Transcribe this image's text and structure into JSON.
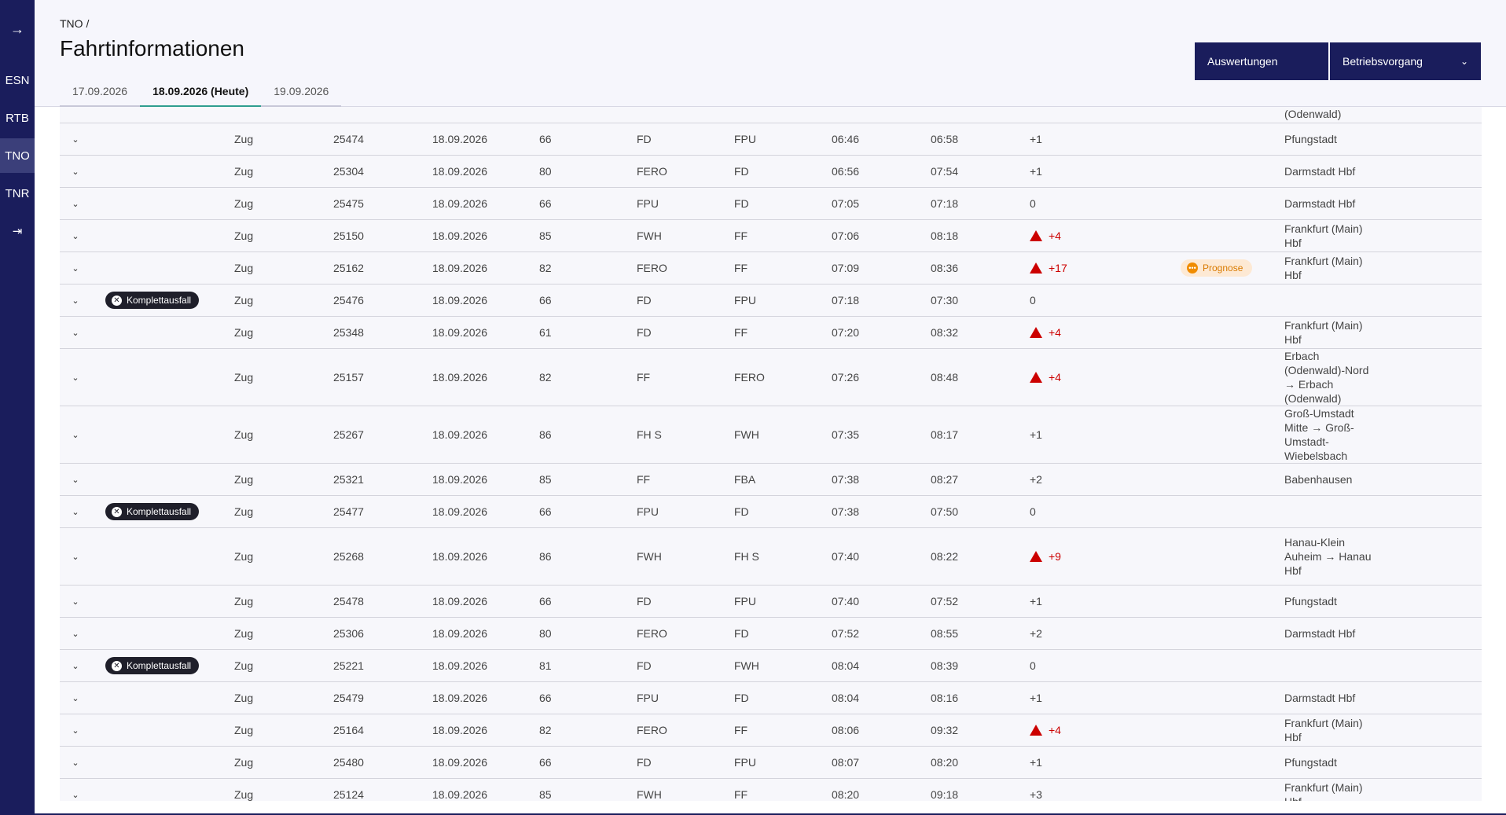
{
  "sidebar": {
    "items": [
      {
        "label": "→",
        "name": "collapse-arrow-icon"
      },
      {
        "label": "ESN"
      },
      {
        "label": "RTB"
      },
      {
        "label": "TNO"
      },
      {
        "label": "TNR"
      },
      {
        "label": "⇥",
        "name": "logout-icon"
      }
    ],
    "active": "TNO"
  },
  "header": {
    "breadcrumb": "TNO  /",
    "title": "Fahrtinformationen",
    "tabs": [
      {
        "label": "17.09.2026"
      },
      {
        "label": "18.09.2026 (Heute)",
        "active": true
      },
      {
        "label": "19.09.2026"
      }
    ],
    "btn_auswertungen": "Auswertungen",
    "btn_betriebsvorgang": "Betriebsvorgang"
  },
  "colors": {
    "primary": "#1a1d5c",
    "late": "#cc0000",
    "accent_tab": "#2f9e8f",
    "prognose": "#f08c00"
  },
  "badge_label": "Komplettausfall",
  "prognose_label": "Prognose",
  "rows": [
    {
      "type": "Zug",
      "nr": "25474",
      "date": "18.09.2026",
      "line": "66",
      "from": "FD",
      "to": "FPU",
      "dep": "06:46",
      "arr": "06:58",
      "delay": "+1",
      "late": false,
      "dest": "Pfungstadt"
    },
    {
      "type": "Zug",
      "nr": "25304",
      "date": "18.09.2026",
      "line": "80",
      "from": "FERO",
      "to": "FD",
      "dep": "06:56",
      "arr": "07:54",
      "delay": "+1",
      "late": false,
      "dest": "Darmstadt Hbf"
    },
    {
      "type": "Zug",
      "nr": "25475",
      "date": "18.09.2026",
      "line": "66",
      "from": "FPU",
      "to": "FD",
      "dep": "07:05",
      "arr": "07:18",
      "delay": "0",
      "late": false,
      "dest": "Darmstadt Hbf"
    },
    {
      "type": "Zug",
      "nr": "25150",
      "date": "18.09.2026",
      "line": "85",
      "from": "FWH",
      "to": "FF",
      "dep": "07:06",
      "arr": "08:18",
      "delay": "+4",
      "late": true,
      "dest": "Frankfurt (Main) Hbf"
    },
    {
      "type": "Zug",
      "nr": "25162",
      "date": "18.09.2026",
      "line": "82",
      "from": "FERO",
      "to": "FF",
      "dep": "07:09",
      "arr": "08:36",
      "delay": "+17",
      "late": true,
      "prognose": true,
      "dest": "Frankfurt (Main) Hbf"
    },
    {
      "type": "Zug",
      "nr": "25476",
      "date": "18.09.2026",
      "line": "66",
      "from": "FD",
      "to": "FPU",
      "dep": "07:18",
      "arr": "07:30",
      "delay": "0",
      "late": false,
      "cancelled": true,
      "dest": ""
    },
    {
      "type": "Zug",
      "nr": "25348",
      "date": "18.09.2026",
      "line": "61",
      "from": "FD",
      "to": "FF",
      "dep": "07:20",
      "arr": "08:32",
      "delay": "+4",
      "late": true,
      "dest": "Frankfurt (Main) Hbf"
    },
    {
      "type": "Zug",
      "nr": "25157",
      "date": "18.09.2026",
      "line": "82",
      "from": "FF",
      "to": "FERO",
      "dep": "07:26",
      "arr": "08:48",
      "delay": "+4",
      "late": true,
      "dest": "Erbach (Odenwald)-Nord → Erbach (Odenwald)"
    },
    {
      "type": "Zug",
      "nr": "25267",
      "date": "18.09.2026",
      "line": "86",
      "from": "FH S",
      "to": "FWH",
      "dep": "07:35",
      "arr": "08:17",
      "delay": "+1",
      "late": false,
      "dest": "Groß-Umstadt Mitte → Groß-Umstadt-Wiebelsbach"
    },
    {
      "type": "Zug",
      "nr": "25321",
      "date": "18.09.2026",
      "line": "85",
      "from": "FF",
      "to": "FBA",
      "dep": "07:38",
      "arr": "08:27",
      "delay": "+2",
      "late": false,
      "dest": "Babenhausen"
    },
    {
      "type": "Zug",
      "nr": "25477",
      "date": "18.09.2026",
      "line": "66",
      "from": "FPU",
      "to": "FD",
      "dep": "07:38",
      "arr": "07:50",
      "delay": "0",
      "late": false,
      "cancelled": true,
      "dest": ""
    },
    {
      "type": "Zug",
      "nr": "25268",
      "date": "18.09.2026",
      "line": "86",
      "from": "FWH",
      "to": "FH S",
      "dep": "07:40",
      "arr": "08:22",
      "delay": "+9",
      "late": true,
      "dest": "Hanau-Klein Auheim → Hanau Hbf"
    },
    {
      "type": "Zug",
      "nr": "25478",
      "date": "18.09.2026",
      "line": "66",
      "from": "FD",
      "to": "FPU",
      "dep": "07:40",
      "arr": "07:52",
      "delay": "+1",
      "late": false,
      "dest": "Pfungstadt"
    },
    {
      "type": "Zug",
      "nr": "25306",
      "date": "18.09.2026",
      "line": "80",
      "from": "FERO",
      "to": "FD",
      "dep": "07:52",
      "arr": "08:55",
      "delay": "+2",
      "late": false,
      "dest": "Darmstadt Hbf"
    },
    {
      "type": "Zug",
      "nr": "25221",
      "date": "18.09.2026",
      "line": "81",
      "from": "FD",
      "to": "FWH",
      "dep": "08:04",
      "arr": "08:39",
      "delay": "0",
      "late": false,
      "cancelled": true,
      "dest": ""
    },
    {
      "type": "Zug",
      "nr": "25479",
      "date": "18.09.2026",
      "line": "66",
      "from": "FPU",
      "to": "FD",
      "dep": "08:04",
      "arr": "08:16",
      "delay": "+1",
      "late": false,
      "dest": "Darmstadt Hbf"
    },
    {
      "type": "Zug",
      "nr": "25164",
      "date": "18.09.2026",
      "line": "82",
      "from": "FERO",
      "to": "FF",
      "dep": "08:06",
      "arr": "09:32",
      "delay": "+4",
      "late": true,
      "dest": "Frankfurt (Main) Hbf"
    },
    {
      "type": "Zug",
      "nr": "25480",
      "date": "18.09.2026",
      "line": "66",
      "from": "FD",
      "to": "FPU",
      "dep": "08:07",
      "arr": "08:20",
      "delay": "+1",
      "late": false,
      "dest": "Pfungstadt"
    },
    {
      "type": "Zug",
      "nr": "25124",
      "date": "18.09.2026",
      "line": "85",
      "from": "FWH",
      "to": "FF",
      "dep": "08:20",
      "arr": "09:18",
      "delay": "+3",
      "late": false,
      "dest": "Frankfurt (Main) Hbf"
    }
  ]
}
